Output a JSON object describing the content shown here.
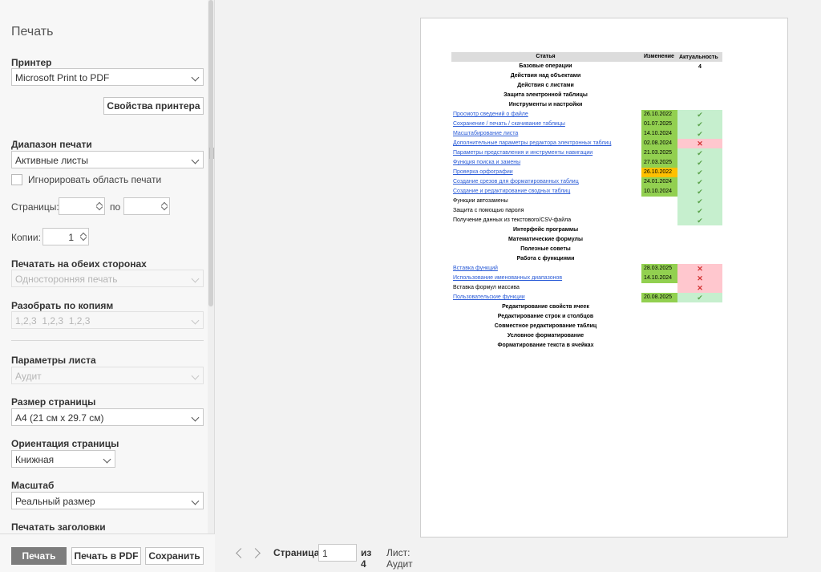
{
  "title": "Печать",
  "printer": {
    "label": "Принтер",
    "value": "Microsoft Print to PDF",
    "props_button": "Свойства принтера"
  },
  "range": {
    "label": "Диапазон печати",
    "value": "Активные листы",
    "ignore_area": "Игнорировать область печати",
    "pages_label": "Страницы:",
    "pages_to": "по",
    "pages_from_value": "",
    "pages_to_value": ""
  },
  "copies": {
    "label": "Копии:",
    "value": "1"
  },
  "duplex": {
    "label": "Печатать на обеих сторонах",
    "value": "Односторонняя печать"
  },
  "collate": {
    "label": "Разобрать по копиям",
    "value": "1,2,3  1,2,3  1,2,3"
  },
  "sheet_params": {
    "label": "Параметры листа",
    "value": "Аудит"
  },
  "page_size": {
    "label": "Размер страницы",
    "value": "A4 (21 см x 29.7 см)"
  },
  "orientation": {
    "label": "Ориентация страницы",
    "value": "Книжная"
  },
  "scale": {
    "label": "Масштаб",
    "value": "Реальный размер"
  },
  "print_titles": {
    "label": "Печатать заголовки"
  },
  "footer": {
    "print": "Печать",
    "print_pdf": "Печать в PDF",
    "save": "Сохранить"
  },
  "pager": {
    "page_label": "Страница",
    "page_value": "1",
    "of_label": "из 4",
    "sheet_label": "Лист: Аудит"
  },
  "colors": {
    "green": "#92d050",
    "orange": "#ffc000",
    "pink": "#ffc7ce",
    "lightgreen": "#c6efce",
    "link": "#2a5bd7"
  },
  "preview": {
    "headers": [
      "Статья",
      "Изменение",
      "Актуальность"
    ],
    "rows": [
      {
        "text": "Базовые операции",
        "type": "section",
        "date": "",
        "status": "4",
        "date_color": "",
        "status_color": ""
      },
      {
        "text": "Действия над объектами",
        "type": "section",
        "date": "",
        "status": "",
        "date_color": "",
        "status_color": ""
      },
      {
        "text": "Действия с листами",
        "type": "section",
        "date": "",
        "status": "",
        "date_color": "",
        "status_color": ""
      },
      {
        "text": "Защита электронной таблицы",
        "type": "section",
        "date": "",
        "status": "",
        "date_color": "",
        "status_color": ""
      },
      {
        "text": "Инструменты и настройки",
        "type": "section",
        "date": "",
        "status": "",
        "date_color": "",
        "status_color": ""
      },
      {
        "text": "Просмотр сведений о файле",
        "type": "link",
        "date": "26.10.2022",
        "status": "✔",
        "date_color": "green",
        "status_color": "lightgreen"
      },
      {
        "text": "Сохранение / печать / скачивание таблицы",
        "type": "link",
        "date": "01.07.2025",
        "status": "✔",
        "date_color": "green",
        "status_color": "lightgreen"
      },
      {
        "text": "Масштабирование листа",
        "type": "link",
        "date": "14.10.2024",
        "status": "✔",
        "date_color": "green",
        "status_color": "lightgreen"
      },
      {
        "text": "Дополнительные параметры редактора электронных таблиц",
        "type": "link",
        "date": "02.08.2024",
        "status": "✕",
        "date_color": "green",
        "status_color": "pink"
      },
      {
        "text": "Параметры представления и инструменты навигации",
        "type": "link",
        "date": "21.03.2025",
        "status": "✔",
        "date_color": "green",
        "status_color": "lightgreen"
      },
      {
        "text": "Функция поиска и замены",
        "type": "link",
        "date": "27.03.2025",
        "status": "✔",
        "date_color": "green",
        "status_color": "lightgreen"
      },
      {
        "text": "Проверка орфографии",
        "type": "link",
        "date": "26.10.2022",
        "status": "✔",
        "date_color": "orange",
        "status_color": "lightgreen"
      },
      {
        "text": "Создание срезов для форматированных таблиц",
        "type": "link",
        "date": "24.01.2024",
        "status": "✔",
        "date_color": "green",
        "status_color": "lightgreen"
      },
      {
        "text": "Создание и редактирование сводных таблиц",
        "type": "link",
        "date": "10.10.2024",
        "status": "✔",
        "date_color": "green",
        "status_color": "lightgreen"
      },
      {
        "text": "Функции автозамены",
        "type": "plain",
        "date": "",
        "status": "✔",
        "date_color": "",
        "status_color": "lightgreen"
      },
      {
        "text": "Защита с помощью пароля",
        "type": "plain",
        "date": "",
        "status": "✔",
        "date_color": "",
        "status_color": "lightgreen"
      },
      {
        "text": "Получение данных из текстового/CSV-файла",
        "type": "plain",
        "date": "",
        "status": "✔",
        "date_color": "",
        "status_color": "lightgreen"
      },
      {
        "text": "Интерфейс программы",
        "type": "section",
        "date": "",
        "status": "",
        "date_color": "",
        "status_color": ""
      },
      {
        "text": "Математические формулы",
        "type": "section",
        "date": "",
        "status": "",
        "date_color": "",
        "status_color": ""
      },
      {
        "text": "Полезные советы",
        "type": "section",
        "date": "",
        "status": "",
        "date_color": "",
        "status_color": ""
      },
      {
        "text": "Работа с функциями",
        "type": "section",
        "date": "",
        "status": "",
        "date_color": "",
        "status_color": ""
      },
      {
        "text": "Вставка функций",
        "type": "link",
        "date": "28.03.2025",
        "status": "✕",
        "date_color": "green",
        "status_color": "pink"
      },
      {
        "text": "Использование именованных диапазонов",
        "type": "link",
        "date": "14.10.2024",
        "status": "✕",
        "date_color": "green",
        "status_color": "pink"
      },
      {
        "text": "Вставка формул массива",
        "type": "plain",
        "date": "",
        "status": "✕",
        "date_color": "",
        "status_color": "pink"
      },
      {
        "text": "Пользовательские функции",
        "type": "link",
        "date": "20.08.2025",
        "status": "✔",
        "date_color": "green",
        "status_color": "lightgreen"
      },
      {
        "text": "Редактирование свойств ячеек",
        "type": "section",
        "date": "",
        "status": "",
        "date_color": "",
        "status_color": ""
      },
      {
        "text": "Редактирование строк и столбцов",
        "type": "section",
        "date": "",
        "status": "",
        "date_color": "",
        "status_color": ""
      },
      {
        "text": "Совместное редактирование таблиц",
        "type": "section",
        "date": "",
        "status": "",
        "date_color": "",
        "status_color": ""
      },
      {
        "text": "Условное форматирование",
        "type": "section",
        "date": "",
        "status": "",
        "date_color": "",
        "status_color": ""
      },
      {
        "text": "Форматирование текста в ячейках",
        "type": "section",
        "date": "",
        "status": "",
        "date_color": "",
        "status_color": ""
      }
    ]
  }
}
